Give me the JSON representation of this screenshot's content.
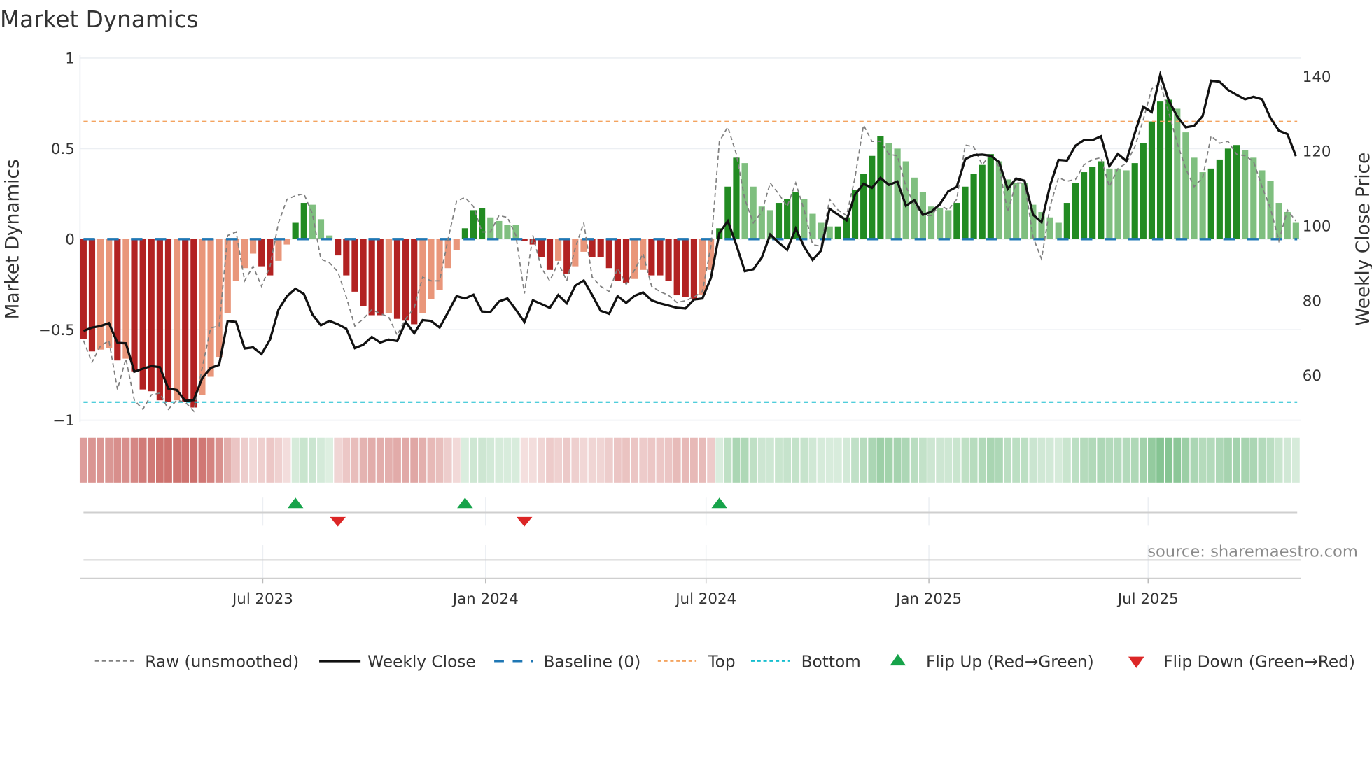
{
  "chart_data": {
    "type": "bar",
    "title": "Market Dynamics",
    "ylabel": "Market Dynamics",
    "y2label": "Weekly Close Price",
    "ylim": [
      -1,
      1
    ],
    "y2lim": [
      48,
      145
    ],
    "y_ticks": [
      {
        "v": 1,
        "label": "1"
      },
      {
        "v": 0.5,
        "label": "0.5"
      },
      {
        "v": 0,
        "label": "0"
      },
      {
        "v": -0.5,
        "label": "−0.5"
      },
      {
        "v": -1,
        "label": "−1"
      }
    ],
    "y2_ticks": [
      {
        "v": 140,
        "label": "140"
      },
      {
        "v": 120,
        "label": "120"
      },
      {
        "v": 100,
        "label": "100"
      },
      {
        "v": 80,
        "label": "80"
      },
      {
        "v": 60,
        "label": "60"
      }
    ],
    "x_start": "2023-02-03",
    "x_frequency": "weekly",
    "x_ticks": [
      {
        "date": "2023-07-01",
        "label": "Jul 2023"
      },
      {
        "date": "2024-01-01",
        "label": "Jan 2024"
      },
      {
        "date": "2024-07-01",
        "label": "Jul 2024"
      },
      {
        "date": "2025-01-01",
        "label": "Jan 2025"
      },
      {
        "date": "2025-07-01",
        "label": "Jul 2025"
      }
    ],
    "thresholds": {
      "top": 0.65,
      "bottom": -0.9,
      "baseline": 0
    },
    "dynamics": [
      -0.55,
      -0.62,
      -0.61,
      -0.6,
      -0.67,
      -0.66,
      -0.73,
      -0.83,
      -0.84,
      -0.89,
      -0.9,
      -0.89,
      -0.9,
      -0.93,
      -0.86,
      -0.76,
      -0.65,
      -0.41,
      -0.23,
      -0.16,
      -0.08,
      -0.15,
      -0.2,
      -0.12,
      -0.03,
      0.09,
      0.2,
      0.19,
      0.11,
      0.02,
      -0.09,
      -0.2,
      -0.29,
      -0.37,
      -0.42,
      -0.42,
      -0.41,
      -0.44,
      -0.45,
      -0.47,
      -0.41,
      -0.33,
      -0.28,
      -0.16,
      -0.06,
      0.06,
      0.16,
      0.17,
      0.12,
      0.1,
      0.08,
      0.08,
      -0.01,
      -0.03,
      -0.1,
      -0.17,
      -0.12,
      -0.19,
      -0.15,
      -0.07,
      -0.1,
      -0.1,
      -0.16,
      -0.23,
      -0.24,
      -0.22,
      -0.17,
      -0.2,
      -0.2,
      -0.23,
      -0.31,
      -0.32,
      -0.33,
      -0.31,
      -0.17,
      0.06,
      0.29,
      0.45,
      0.42,
      0.29,
      0.18,
      0.16,
      0.2,
      0.22,
      0.26,
      0.22,
      0.14,
      0.09,
      0.07,
      0.07,
      0.12,
      0.27,
      0.36,
      0.46,
      0.57,
      0.53,
      0.5,
      0.43,
      0.34,
      0.26,
      0.18,
      0.17,
      0.16,
      0.2,
      0.29,
      0.36,
      0.41,
      0.47,
      0.43,
      0.33,
      0.31,
      0.31,
      0.19,
      0.15,
      0.12,
      0.09,
      0.2,
      0.31,
      0.37,
      0.4,
      0.43,
      0.39,
      0.39,
      0.38,
      0.42,
      0.53,
      0.65,
      0.76,
      0.77,
      0.72,
      0.59,
      0.45,
      0.37,
      0.39,
      0.44,
      0.5,
      0.52,
      0.49,
      0.45,
      0.38,
      0.32,
      0.2,
      0.15,
      0.09
    ],
    "strengthening": [
      1,
      1,
      0,
      0,
      1,
      0,
      1,
      1,
      1,
      1,
      1,
      0,
      1,
      1,
      0,
      0,
      0,
      0,
      0,
      0,
      0,
      1,
      1,
      0,
      0,
      1,
      1,
      0,
      0,
      0,
      1,
      1,
      1,
      1,
      1,
      1,
      0,
      1,
      1,
      1,
      0,
      0,
      0,
      0,
      0,
      1,
      1,
      1,
      0,
      0,
      0,
      0,
      1,
      1,
      1,
      1,
      0,
      1,
      0,
      0,
      1,
      1,
      1,
      1,
      1,
      0,
      0,
      1,
      1,
      1,
      1,
      1,
      1,
      0,
      0,
      1,
      1,
      1,
      0,
      0,
      0,
      0,
      1,
      1,
      1,
      0,
      0,
      0,
      0,
      1,
      1,
      1,
      1,
      1,
      1,
      0,
      0,
      0,
      0,
      0,
      0,
      0,
      0,
      1,
      1,
      1,
      1,
      1,
      0,
      0,
      0,
      0,
      0,
      0,
      0,
      0,
      1,
      1,
      1,
      1,
      1,
      0,
      0,
      0,
      1,
      1,
      1,
      1,
      1,
      0,
      0,
      0,
      0,
      1,
      1,
      1,
      1,
      0,
      0,
      0,
      0,
      0,
      0,
      0
    ],
    "raw": [
      -0.56,
      -0.68,
      -0.59,
      -0.56,
      -0.83,
      -0.66,
      -0.89,
      -0.94,
      -0.86,
      -0.85,
      -0.94,
      -0.89,
      -0.9,
      -0.95,
      -0.71,
      -0.49,
      -0.48,
      0.02,
      0.04,
      -0.23,
      -0.15,
      -0.26,
      -0.15,
      0.09,
      0.22,
      0.24,
      0.25,
      0.14,
      -0.11,
      -0.13,
      -0.18,
      -0.32,
      -0.48,
      -0.44,
      -0.39,
      -0.41,
      -0.43,
      -0.53,
      -0.44,
      -0.38,
      -0.21,
      -0.23,
      -0.23,
      0.0,
      0.21,
      0.23,
      0.18,
      0.04,
      0.04,
      0.13,
      0.12,
      0.02,
      -0.3,
      0.02,
      -0.16,
      -0.23,
      -0.13,
      -0.23,
      -0.05,
      0.09,
      -0.21,
      -0.26,
      -0.29,
      -0.16,
      -0.25,
      -0.17,
      -0.08,
      -0.26,
      -0.29,
      -0.31,
      -0.35,
      -0.34,
      -0.32,
      -0.29,
      -0.04,
      0.54,
      0.62,
      0.47,
      0.22,
      0.09,
      0.15,
      0.31,
      0.25,
      0.18,
      0.31,
      0.16,
      -0.03,
      -0.04,
      0.22,
      0.16,
      0.13,
      0.34,
      0.63,
      0.54,
      0.54,
      0.47,
      0.46,
      0.29,
      0.19,
      0.13,
      0.13,
      0.19,
      0.16,
      0.22,
      0.52,
      0.51,
      0.41,
      0.47,
      0.4,
      0.15,
      0.31,
      0.31,
      0.01,
      -0.11,
      0.18,
      0.34,
      0.32,
      0.33,
      0.41,
      0.44,
      0.45,
      0.29,
      0.39,
      0.42,
      0.51,
      0.66,
      0.83,
      0.86,
      0.7,
      0.53,
      0.39,
      0.29,
      0.34,
      0.57,
      0.53,
      0.54,
      0.47,
      0.46,
      0.43,
      0.29,
      0.17,
      -0.01,
      0.16,
      0.1
    ],
    "weekly_close": [
      71.9,
      72.8,
      73.2,
      74.0,
      68.7,
      68.6,
      61.0,
      61.8,
      62.5,
      62.2,
      56.5,
      56.1,
      53.2,
      53.4,
      59.3,
      62.0,
      62.8,
      74.6,
      74.3,
      67.2,
      67.5,
      65.7,
      69.6,
      77.6,
      81.2,
      83.2,
      81.8,
      76.3,
      73.4,
      74.6,
      73.7,
      72.5,
      67.3,
      68.2,
      70.3,
      68.8,
      69.6,
      69.2,
      74.3,
      71.3,
      74.8,
      74.6,
      72.8,
      76.9,
      81.2,
      80.6,
      81.6,
      77.1,
      77.0,
      79.8,
      80.6,
      77.6,
      74.3,
      80.1,
      79.1,
      78.1,
      81.5,
      79.3,
      84.0,
      85.4,
      81.5,
      77.3,
      76.5,
      81.2,
      79.4,
      81.3,
      82.2,
      80.1,
      79.3,
      78.7,
      78.1,
      77.9,
      80.3,
      80.6,
      86.1,
      98.1,
      101.3,
      94.9,
      87.9,
      88.4,
      91.5,
      97.7,
      95.5,
      93.6,
      99.3,
      94.4,
      90.9,
      93.4,
      104.6,
      103.0,
      101.5,
      108.4,
      111.3,
      110.2,
      112.9,
      111.0,
      111.9,
      105.4,
      106.9,
      103.0,
      103.8,
      105.8,
      109.3,
      110.5,
      117.9,
      119.0,
      119.1,
      118.8,
      117.1,
      109.9,
      112.7,
      112.1,
      103.0,
      101.0,
      110.8,
      117.7,
      117.5,
      121.5,
      123.0,
      123.0,
      124.0,
      116.0,
      119.3,
      117.4,
      124.9,
      131.9,
      130.5,
      140.5,
      133.6,
      129.3,
      126.4,
      126.8,
      129.4,
      138.9,
      138.6,
      136.4,
      135.1,
      133.9,
      134.6,
      133.9,
      128.9,
      125.5,
      124.6,
      118.7
    ],
    "flips": [
      {
        "index": 25,
        "direction": "up"
      },
      {
        "index": 30,
        "direction": "down"
      },
      {
        "index": 45,
        "direction": "up"
      },
      {
        "index": 52,
        "direction": "down"
      },
      {
        "index": 75,
        "direction": "up"
      }
    ],
    "colors": {
      "red_strong": "#b22222",
      "red_weak": "#e9967a",
      "green_strong": "#228b22",
      "green_weak": "#7fbf7f",
      "baseline": "#1f77b4",
      "top": "#f4a460",
      "bottom": "#17becf",
      "raw": "#808080",
      "close": "#111111",
      "flip_up": "#16a34a",
      "flip_down": "#dc2626"
    },
    "legend": {
      "placement": "bottom",
      "raw": "Raw (unsmoothed)",
      "close": "Weekly Close",
      "baseline": "Baseline (0)",
      "top": "Top",
      "bottom": "Bottom",
      "flip_up": "Flip Up (Red→Green)",
      "flip_down": "Flip Down (Green→Red)"
    },
    "source": "source: sharemaestro.com"
  }
}
